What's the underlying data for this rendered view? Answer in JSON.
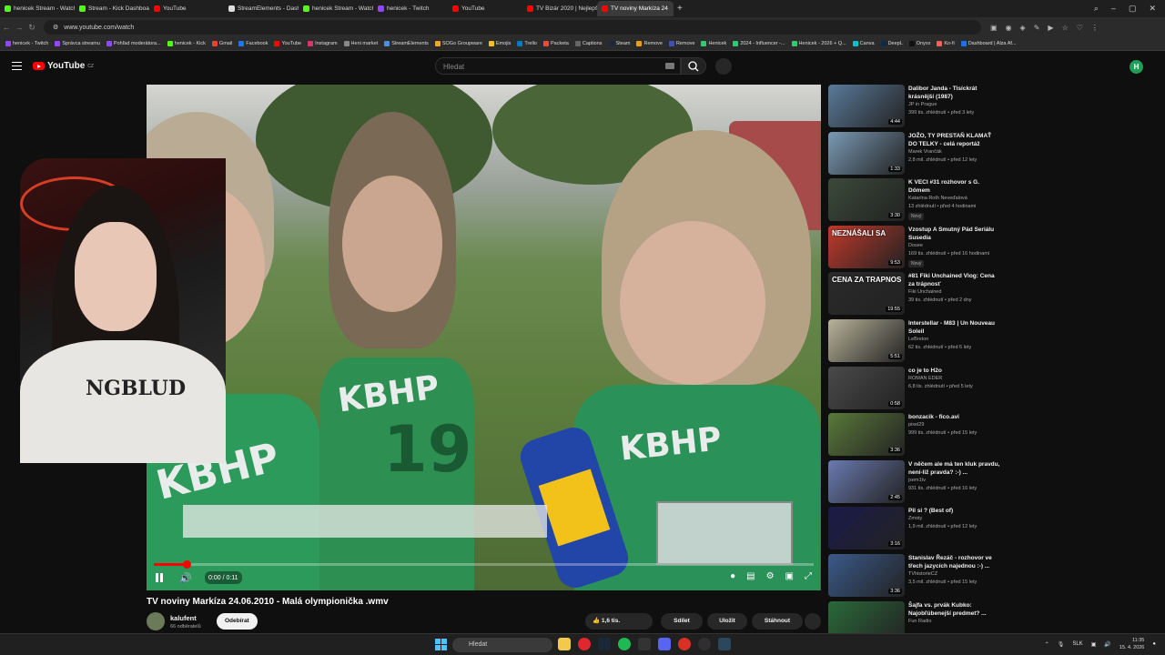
{
  "browser": {
    "tabs": [
      {
        "label": "henicek Stream - Watch Li",
        "color": "#53fc18"
      },
      {
        "label": "Stream - Kick Dashboard",
        "color": "#53fc18"
      },
      {
        "label": "YouTube",
        "color": "#ff0000"
      },
      {
        "label": "StreamElements - Dashb",
        "color": "#dddddd"
      },
      {
        "label": "henicek Stream - Watch Li",
        "color": "#53fc18"
      },
      {
        "label": "henicek - Twitch",
        "color": "#9146ff"
      },
      {
        "label": "YouTube",
        "color": "#ff0000"
      },
      {
        "label": "TV Bizár 2020 | Nejlepší p",
        "color": "#ff0000"
      },
      {
        "label": "TV noviny Markíza 24",
        "color": "#ff0000",
        "active": true
      }
    ],
    "url": "www.youtube.com/watch",
    "bookmarks": [
      "henicek - Twitch",
      "Správca streamu",
      "Pohľad moderátora...",
      "henicek - Kick",
      "Gmail",
      "Facebook",
      "YouTube",
      "Instagram",
      "Heni market",
      "StreamElements",
      "SOGo Groupware",
      "Emojis",
      "Trello",
      "Packeta",
      "Captions",
      "Steam",
      "Remove",
      "Remove",
      "Henicek",
      "2024 - Influencer -...",
      "Henicek - 2026 + Q...",
      "Canva",
      "DeepL",
      "Onyxx",
      "Ko-fi",
      "Dashboard | Alza Af..."
    ]
  },
  "youtube": {
    "logo": "YouTube",
    "region": "CZ",
    "search_placeholder": "Hledat",
    "avatar_letter": "H"
  },
  "player": {
    "time": "0:00 / 0:11",
    "progress": 0.05,
    "shirt_text": "KBHP"
  },
  "webcam": {
    "shirt_text": "NGBLUD"
  },
  "video": {
    "title": "TV noviny Markíza 24.06.2010 - Malá olympionička .wmv",
    "channel": "kalufent",
    "subscribers": "66 odběratelů",
    "subscribe_label": "Odebírat",
    "likes": "1,6 tis.",
    "share_label": "Sdílet",
    "save_label": "Uložit",
    "download_label": "Stáhnout"
  },
  "recommendations": [
    {
      "title": "Dalibor Janda - Tisíckrát krásnější (1987)",
      "channel": "JP in Prague",
      "meta": "399 tis. zhlédnutí • před 3 lety",
      "duration": "4:44",
      "color": "#5a7a9a"
    },
    {
      "title": "JOŽO, TY PRESTAŇ KLAMAŤ DO TELKY - celá reportáž",
      "channel": "Marek Vrančák",
      "meta": "2,8 mil. zhlédnutí • před 12 lety",
      "duration": "1:33",
      "color": "#7a9ab5"
    },
    {
      "title": "K VECI #31 rozhovor s G. Dömem",
      "channel": "Katarína Roth Neveďalová",
      "meta": "13 zhlédnutí • před 4 hodinami",
      "duration": "3:30",
      "badge": "Nový",
      "color": "#3b4a3a"
    },
    {
      "title": "Vzostup A Smutný Pád Seriálu Susedia",
      "channel": "Dosee",
      "meta": "169 tis. zhlédnutí • před 16 hodinami",
      "duration": "9:53",
      "badge": "Nový",
      "color": "#c0392b",
      "thumb_text": "NEZNÁŠALI SA"
    },
    {
      "title": "#81 Fiki Unchained Vlog: Cena za trápnosť",
      "channel": "Fiki Unchained",
      "meta": "39 tis. zhlédnutí • před 2 dny",
      "duration": "19:55",
      "color": "#2a2a2a",
      "thumb_text": "CENA ZA TRAPNOS"
    },
    {
      "title": "Interstellar - M83 | Un Nouveau Soleil",
      "channel": "LeBreton",
      "meta": "62 tis. zhlédnutí • před 6 lety",
      "duration": "5:51",
      "color": "#b8b39a"
    },
    {
      "title": "co je to H2o",
      "channel": "ROMAN EDER",
      "meta": "6,8 tis. zhlédnutí • před 5 lety",
      "duration": "0:58",
      "color": "#4a4a4a"
    },
    {
      "title": "bonzacik - fico.avi",
      "channel": "pixel29",
      "meta": "999 tis. zhlédnutí • před 15 lety",
      "duration": "3:36",
      "color": "#5a7a3a"
    },
    {
      "title": "V něčem ale má ten kluk pravdu, není-liž pravda? :-) ...",
      "channel": "jsem1tv",
      "meta": "931 tis. zhlédnutí • před 16 lety",
      "duration": "2:45",
      "color": "#6a7ab0"
    },
    {
      "title": "Pil si ? (Best of)",
      "channel": "Zmoty",
      "meta": "1,9 mil. zhlédnutí • před 12 lety",
      "duration": "3:16",
      "color": "#1a1a4a"
    },
    {
      "title": "Stanislav Řezáč - rozhovor ve třech jazycích najednou :-) ...",
      "channel": "TVhistorieCZ",
      "meta": "3,5 mil. zhlédnutí • před 15 lety",
      "duration": "3:36",
      "color": "#3a5a8a"
    },
    {
      "title": "Šajfa vs. prvák Kubko: Najobľúbenejší predmet? ...",
      "channel": "Fun Radio",
      "meta": "",
      "duration": "",
      "color": "#2a6a3a"
    }
  ],
  "taskbar": {
    "search_label": "Hledat",
    "lang": "SLK",
    "time": "11:35",
    "date": "15. 4. 2026"
  }
}
